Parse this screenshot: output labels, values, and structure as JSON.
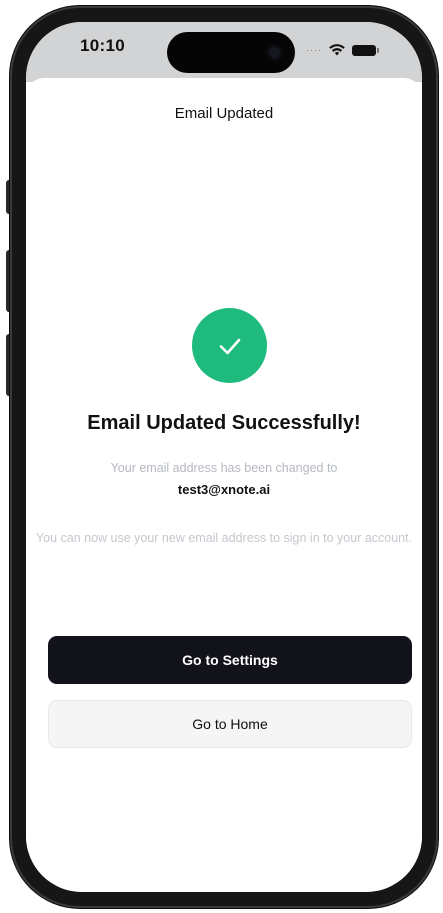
{
  "status_bar": {
    "time": "10:10",
    "signal_icon": "signal-dots-icon",
    "wifi_icon": "wifi-icon",
    "battery_icon": "battery-icon"
  },
  "header": {
    "title": "Email Updated"
  },
  "success": {
    "icon": "checkmark-icon",
    "icon_color": "#1fbb7e",
    "headline": "Email Updated Successfully!",
    "message": "Your email address has been changed to",
    "email": "test3@xnote.ai",
    "info": "You can now use your new email address to sign in to your account."
  },
  "actions": {
    "primary_label": "Go to Settings",
    "secondary_label": "Go to Home"
  },
  "colors": {
    "primary_button": "#12121a",
    "secondary_button": "#f5f5f6",
    "accent": "#1fbb7e"
  }
}
